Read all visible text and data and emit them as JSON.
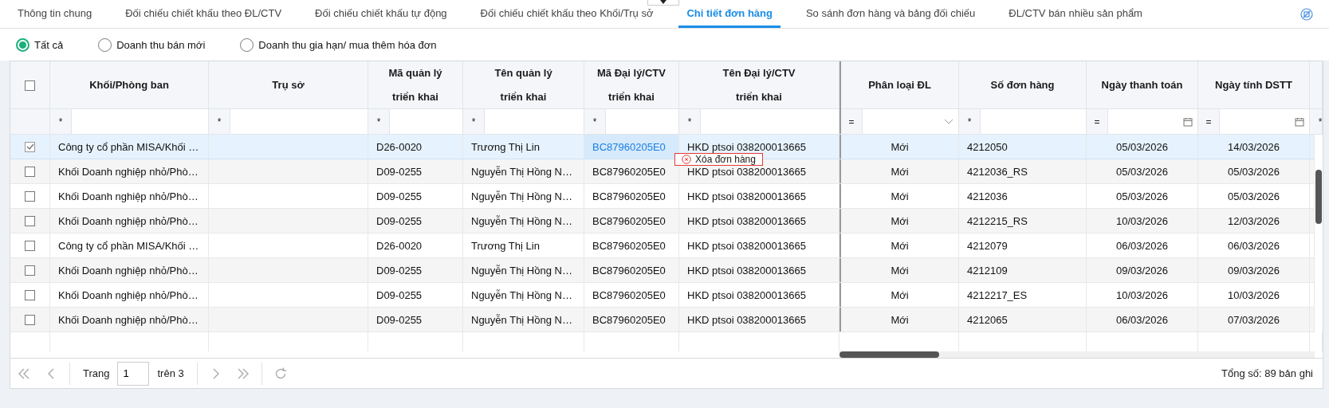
{
  "tabs": [
    {
      "label": "Thông tin chung",
      "selected": false
    },
    {
      "label": "Đối chiếu chiết khấu theo ĐL/CTV",
      "selected": false
    },
    {
      "label": "Đối chiếu chiết khấu tự động",
      "selected": false
    },
    {
      "label": "Đối chiếu chiết khấu theo Khối/Trụ sở",
      "selected": false
    },
    {
      "label": "Chi tiết đơn hàng",
      "selected": true
    },
    {
      "label": "So sánh đơn hàng và bảng đối chiếu",
      "selected": false
    },
    {
      "label": "ĐL/CTV bán nhiều sản phẩm",
      "selected": false
    }
  ],
  "filters": [
    {
      "label": "Tất cả",
      "selected": true
    },
    {
      "label": "Doanh thu bán mới",
      "selected": false
    },
    {
      "label": "Doanh thu gia hạn/ mua thêm hóa đơn",
      "selected": false
    }
  ],
  "table": {
    "select_all": {
      "checked": false
    },
    "columns": [
      {
        "label": "Khối/Phòng ban",
        "kind": "text",
        "filter_operator": "*"
      },
      {
        "label": "Trụ sở",
        "kind": "text",
        "filter_operator": "*"
      },
      {
        "label": "Mã quản lý\ntriển khai",
        "kind": "text",
        "filter_operator": "*"
      },
      {
        "label": "Tên quản lý\ntriển khai",
        "kind": "text",
        "filter_operator": "*"
      },
      {
        "label": "Mã Đại lý/CTV\ntriển khai",
        "kind": "text",
        "filter_operator": "*"
      },
      {
        "label": "Tên Đại lý/CTV\ntriển khai",
        "kind": "text",
        "filter_operator": "*"
      },
      {
        "label": "Phân loại ĐL",
        "kind": "category",
        "filter_operator": "="
      },
      {
        "label": "Số đơn hàng",
        "kind": "text",
        "filter_operator": "*"
      },
      {
        "label": "Ngày thanh toán",
        "kind": "date",
        "filter_operator": "="
      },
      {
        "label": "Ngày tính DSTT",
        "kind": "date",
        "filter_operator": "="
      }
    ],
    "partial_column": {
      "filter_operator": "*"
    },
    "rows": [
      {
        "selected": true,
        "cells": [
          {
            "text": "Công ty cổ phần MISA/Khối …",
            "focused": false
          },
          {
            "focused": false
          },
          {
            "text": "D26-0020",
            "focused": false
          },
          {
            "text": "Trương Thị Lin",
            "focused": false
          },
          {
            "text": "BC87960205E0",
            "focused": true
          },
          {
            "text": "HKD ptsoi 038200013665",
            "focused": false
          },
          {
            "text": "Mới",
            "focused": false
          },
          {
            "text": "4212050",
            "focused": false
          },
          {
            "text": "05/03/2026",
            "focused": false
          },
          {
            "text": "14/03/2026",
            "focused": false
          }
        ]
      },
      {
        "selected": false,
        "cells": [
          {
            "text": "Khối Doanh nghiệp nhỏ/Phò…",
            "focused": false
          },
          {
            "focused": false
          },
          {
            "text": "D09-0255",
            "focused": false
          },
          {
            "text": "Nguyễn Thị Hồng N…",
            "focused": false
          },
          {
            "text": "BC87960205E0",
            "focused": false
          },
          {
            "text": "HKD ptsoi 038200013665",
            "focused": false
          },
          {
            "text": "Mới",
            "focused": false
          },
          {
            "text": "4212036_RS",
            "focused": false
          },
          {
            "text": "05/03/2026",
            "focused": false
          },
          {
            "text": "05/03/2026",
            "focused": false
          }
        ]
      },
      {
        "selected": false,
        "cells": [
          {
            "text": "Khối Doanh nghiệp nhỏ/Phò…",
            "focused": false
          },
          {
            "focused": false
          },
          {
            "text": "D09-0255",
            "focused": false
          },
          {
            "text": "Nguyễn Thị Hồng N…",
            "focused": false
          },
          {
            "text": "BC87960205E0",
            "focused": false
          },
          {
            "text": "HKD ptsoi 038200013665",
            "focused": false
          },
          {
            "text": "Mới",
            "focused": false
          },
          {
            "text": "4212036",
            "focused": false
          },
          {
            "text": "05/03/2026",
            "focused": false
          },
          {
            "text": "05/03/2026",
            "focused": false
          }
        ]
      },
      {
        "selected": false,
        "cells": [
          {
            "text": "Khối Doanh nghiệp nhỏ/Phò…",
            "focused": false
          },
          {
            "focused": false
          },
          {
            "text": "D09-0255",
            "focused": false
          },
          {
            "text": "Nguyễn Thị Hồng N…",
            "focused": false
          },
          {
            "text": "BC87960205E0",
            "focused": false
          },
          {
            "text": "HKD ptsoi 038200013665",
            "focused": false
          },
          {
            "text": "Mới",
            "focused": false
          },
          {
            "text": "4212215_RS",
            "focused": false
          },
          {
            "text": "10/03/2026",
            "focused": false
          },
          {
            "text": "12/03/2026",
            "focused": false
          }
        ]
      },
      {
        "selected": false,
        "cells": [
          {
            "text": "Công ty cổ phần MISA/Khối …",
            "focused": false
          },
          {
            "focused": false
          },
          {
            "text": "D26-0020",
            "focused": false
          },
          {
            "text": "Trương Thị Lin",
            "focused": false
          },
          {
            "text": "BC87960205E0",
            "focused": false
          },
          {
            "text": "HKD ptsoi 038200013665",
            "focused": false
          },
          {
            "text": "Mới",
            "focused": false
          },
          {
            "text": "4212079",
            "focused": false
          },
          {
            "text": "06/03/2026",
            "focused": false
          },
          {
            "text": "06/03/2026",
            "focused": false
          }
        ]
      },
      {
        "selected": false,
        "cells": [
          {
            "text": "Khối Doanh nghiệp nhỏ/Phò…",
            "focused": false
          },
          {
            "focused": false
          },
          {
            "text": "D09-0255",
            "focused": false
          },
          {
            "text": "Nguyễn Thị Hồng N…",
            "focused": false
          },
          {
            "text": "BC87960205E0",
            "focused": false
          },
          {
            "text": "HKD ptsoi 038200013665",
            "focused": false
          },
          {
            "text": "Mới",
            "focused": false
          },
          {
            "text": "4212109",
            "focused": false
          },
          {
            "text": "09/03/2026",
            "focused": false
          },
          {
            "text": "09/03/2026",
            "focused": false
          }
        ]
      },
      {
        "selected": false,
        "cells": [
          {
            "text": "Khối Doanh nghiệp nhỏ/Phò…",
            "focused": false
          },
          {
            "focused": false
          },
          {
            "text": "D09-0255",
            "focused": false
          },
          {
            "text": "Nguyễn Thị Hồng N…",
            "focused": false
          },
          {
            "text": "BC87960205E0",
            "focused": false
          },
          {
            "text": "HKD ptsoi 038200013665",
            "focused": false
          },
          {
            "text": "Mới",
            "focused": false
          },
          {
            "text": "4212217_ES",
            "focused": false
          },
          {
            "text": "10/03/2026",
            "focused": false
          },
          {
            "text": "10/03/2026",
            "focused": false
          }
        ]
      },
      {
        "selected": false,
        "cells": [
          {
            "text": "Khối Doanh nghiệp nhỏ/Phò…",
            "focused": false
          },
          {
            "focused": false
          },
          {
            "text": "D09-0255",
            "focused": false
          },
          {
            "text": "Nguyễn Thị Hồng N…",
            "focused": false
          },
          {
            "text": "BC87960205E0",
            "focused": false
          },
          {
            "text": "HKD ptsoi 038200013665",
            "focused": false
          },
          {
            "text": "Mới",
            "focused": false
          },
          {
            "text": "4212065",
            "focused": false
          },
          {
            "text": "06/03/2026",
            "focused": false
          },
          {
            "text": "07/03/2026",
            "focused": false
          }
        ]
      }
    ]
  },
  "context_menu": {
    "items": [
      {
        "label": "Xóa đơn hàng"
      }
    ]
  },
  "pager": {
    "page_label": "Trang",
    "page": "1",
    "of_label": "trên 3",
    "total": "Tổng số: 89 bản ghi"
  }
}
